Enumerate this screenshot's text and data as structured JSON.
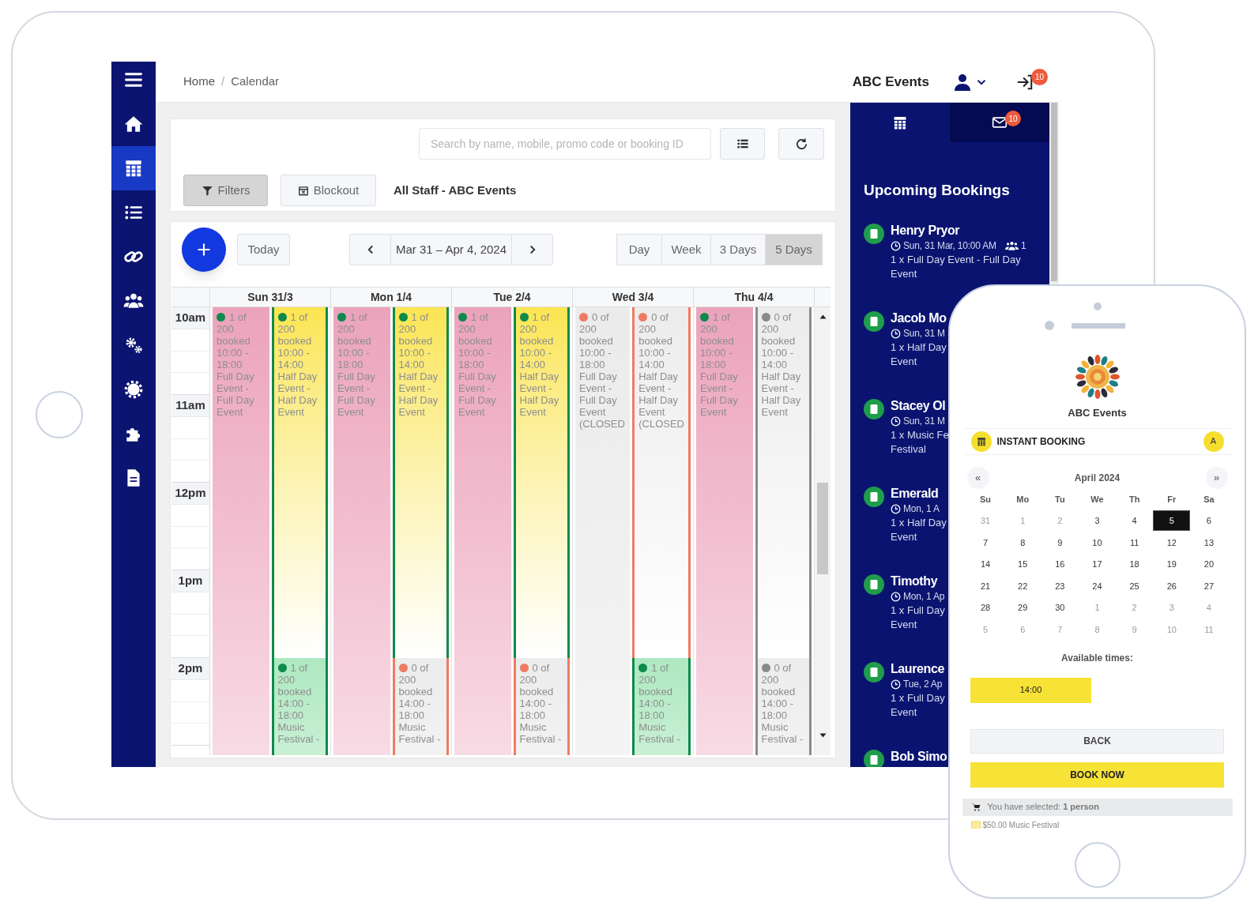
{
  "sidebar": {
    "items": [
      {
        "selected": false
      },
      {
        "selected": false
      },
      {
        "selected": true
      },
      {
        "selected": false
      },
      {
        "selected": false
      },
      {
        "selected": false
      },
      {
        "selected": false
      },
      {
        "selected": false
      },
      {
        "selected": false
      },
      {
        "selected": false
      }
    ]
  },
  "breadcrumb": {
    "items": [
      "Home",
      "Calendar"
    ],
    "separator": "/"
  },
  "header": {
    "org": "ABC Events",
    "notification_count": "10"
  },
  "search": {
    "placeholder": "Search by name, mobile, promo code or booking ID"
  },
  "filters_button": "Filters",
  "blockout_button": "Blockout",
  "staff_label": "All Staff - ABC Events",
  "toolbar": {
    "today": "Today",
    "range": "Mar 31 – Apr 4, 2024",
    "views": [
      {
        "label": "Day",
        "selected": false
      },
      {
        "label": "Week",
        "selected": false
      },
      {
        "label": "3 Days",
        "selected": false
      },
      {
        "label": "5 Days",
        "selected": true
      }
    ]
  },
  "calendar": {
    "hours": [
      "10am",
      "11am",
      "12pm",
      "1pm",
      "2pm"
    ],
    "days": [
      {
        "label": "Sun 31/3",
        "lanes": [
          {
            "events": [
              {
                "kind": "full_day",
                "booked": true,
                "color": "#0e8a4a",
                "count": "1 of 200 booked",
                "time": "10:00 - 18:00",
                "title": "Full Day Event - Full Day Event"
              }
            ]
          },
          {
            "events": [
              {
                "kind": "half_day",
                "booked": true,
                "color": "#0e8a4a",
                "count": "1 of 200 booked",
                "time": "10:00 - 14:00",
                "title": "Half Day Event - Half Day Event"
              },
              {
                "kind": "festival",
                "booked": true,
                "color": "#0e8a4a",
                "count": "1 of 200 booked",
                "time": "14:00 - 18:00",
                "title": "Music Festival -"
              }
            ]
          }
        ]
      },
      {
        "label": "Mon 1/4",
        "lanes": [
          {
            "events": [
              {
                "kind": "full_day",
                "booked": true,
                "color": "#0e8a4a",
                "count": "1 of 200 booked",
                "time": "10:00 - 18:00",
                "title": "Full Day Event - Full Day Event"
              }
            ]
          },
          {
            "events": [
              {
                "kind": "half_day",
                "booked": true,
                "color": "#0e8a4a",
                "count": "1 of 200 booked",
                "time": "10:00 - 14:00",
                "title": "Half Day Event - Half Day Event"
              },
              {
                "kind": "festival",
                "booked": false,
                "color": "#f07b62",
                "count": "0 of 200 booked",
                "time": "14:00 - 18:00",
                "title": "Music Festival -"
              }
            ]
          }
        ]
      },
      {
        "label": "Tue 2/4",
        "lanes": [
          {
            "events": [
              {
                "kind": "full_day",
                "booked": true,
                "color": "#0e8a4a",
                "count": "1 of 200 booked",
                "time": "10:00 - 18:00",
                "title": "Full Day Event - Full Day Event"
              }
            ]
          },
          {
            "events": [
              {
                "kind": "half_day",
                "booked": true,
                "color": "#0e8a4a",
                "count": "1 of 200 booked",
                "time": "10:00 - 14:00",
                "title": "Half Day Event - Half Day Event"
              },
              {
                "kind": "festival",
                "booked": false,
                "color": "#f07b62",
                "count": "0 of 200 booked",
                "time": "14:00 - 18:00",
                "title": "Music Festival -"
              }
            ]
          }
        ]
      },
      {
        "label": "Wed 3/4",
        "lanes": [
          {
            "events": [
              {
                "kind": "full_day",
                "booked": false,
                "color": "#f07b62",
                "count": "0 of 200 booked",
                "time": "10:00 - 18:00",
                "title": "Full Day Event - Full Day Event (CLOSED"
              }
            ]
          },
          {
            "events": [
              {
                "kind": "half_day",
                "booked": false,
                "color": "#f07b62",
                "count": "0 of 200 booked",
                "time": "10:00 - 14:00",
                "title": "Half Day Event - Half Day Event (CLOSED"
              },
              {
                "kind": "festival",
                "booked": true,
                "color": "#0e8a4a",
                "count": "1 of 200 booked",
                "time": "14:00 - 18:00",
                "title": "Music Festival -"
              }
            ]
          }
        ]
      },
      {
        "label": "Thu 4/4",
        "lanes": [
          {
            "events": [
              {
                "kind": "full_day",
                "booked": true,
                "color": "#0e8a4a",
                "count": "1 of 200 booked",
                "time": "10:00 - 18:00",
                "title": "Full Day Event - Full Day Event"
              }
            ]
          },
          {
            "events": [
              {
                "kind": "half_day",
                "booked": false,
                "color": "#8a8a8a",
                "count": "0 of 200 booked",
                "time": "10:00 - 14:00",
                "title": "Half Day Event - Half Day Event"
              },
              {
                "kind": "festival",
                "booked": false,
                "color": "#8a8a8a",
                "count": "0 of 200 booked",
                "time": "14:00 - 18:00",
                "title": "Music Festival -"
              }
            ]
          }
        ]
      }
    ]
  },
  "panel": {
    "tabs": [
      {
        "selected": true
      },
      {
        "selected": false,
        "badge": "10"
      }
    ],
    "title": "Upcoming Bookings",
    "bookings": [
      {
        "name": "Henry Pryor",
        "when": "Sun, 31 Mar, 10:00 AM",
        "guests": "1",
        "lines": [
          "1 x Full Day Event - Full Day",
          "Event"
        ]
      },
      {
        "name": "Jacob Mo",
        "when": "Sun, 31 M",
        "lines": [
          "1 x Half Day",
          "Event"
        ]
      },
      {
        "name": "Stacey Ol",
        "when": "Sun, 31 M",
        "lines": [
          "1 x Music Fe",
          "Festival"
        ]
      },
      {
        "name": "Emerald",
        "when": "Mon, 1 A",
        "lines": [
          "1 x Half Day",
          "Event"
        ]
      },
      {
        "name": "Timothy",
        "when": "Mon, 1 Ap",
        "lines": [
          "1 x Full Day",
          "Event"
        ]
      },
      {
        "name": "Laurence",
        "when": "Tue, 2 Ap",
        "lines": [
          "1 x Full Day",
          "Event"
        ]
      },
      {
        "name": "Bob Simo"
      }
    ]
  },
  "phone": {
    "org": "ABC Events",
    "booking_title": "INSTANT BOOKING",
    "avatar": "A",
    "prev": "«",
    "next": "»",
    "month": "April 2024",
    "weekdays": [
      "Su",
      "Mo",
      "Tu",
      "We",
      "Th",
      "Fr",
      "Sa"
    ],
    "weeks": [
      [
        {
          "day": "31",
          "muted": true,
          "selected": false
        },
        {
          "day": "1",
          "muted": true,
          "selected": false
        },
        {
          "day": "2",
          "muted": true,
          "selected": false
        },
        {
          "day": "3",
          "muted": false,
          "selected": false
        },
        {
          "day": "4",
          "muted": false,
          "selected": false
        },
        {
          "day": "5",
          "muted": false,
          "selected": true
        },
        {
          "day": "6",
          "muted": false,
          "selected": false
        }
      ],
      [
        {
          "day": "7",
          "muted": false,
          "selected": false
        },
        {
          "day": "8",
          "muted": false,
          "selected": false
        },
        {
          "day": "9",
          "muted": false,
          "selected": false
        },
        {
          "day": "10",
          "muted": false,
          "selected": false
        },
        {
          "day": "11",
          "muted": false,
          "selected": false
        },
        {
          "day": "12",
          "muted": false,
          "selected": false
        },
        {
          "day": "13",
          "muted": false,
          "selected": false
        }
      ],
      [
        {
          "day": "14",
          "muted": false,
          "selected": false
        },
        {
          "day": "15",
          "muted": false,
          "selected": false
        },
        {
          "day": "16",
          "muted": false,
          "selected": false
        },
        {
          "day": "17",
          "muted": false,
          "selected": false
        },
        {
          "day": "18",
          "muted": false,
          "selected": false
        },
        {
          "day": "19",
          "muted": false,
          "selected": false
        },
        {
          "day": "20",
          "muted": false,
          "selected": false
        }
      ],
      [
        {
          "day": "21",
          "muted": false,
          "selected": false
        },
        {
          "day": "22",
          "muted": false,
          "selected": false
        },
        {
          "day": "23",
          "muted": false,
          "selected": false
        },
        {
          "day": "24",
          "muted": false,
          "selected": false
        },
        {
          "day": "25",
          "muted": false,
          "selected": false
        },
        {
          "day": "26",
          "muted": false,
          "selected": false
        },
        {
          "day": "27",
          "muted": false,
          "selected": false
        }
      ],
      [
        {
          "day": "28",
          "muted": false,
          "selected": false
        },
        {
          "day": "29",
          "muted": false,
          "selected": false
        },
        {
          "day": "30",
          "muted": false,
          "selected": false
        },
        {
          "day": "1",
          "muted": true,
          "selected": false
        },
        {
          "day": "2",
          "muted": true,
          "selected": false
        },
        {
          "day": "3",
          "muted": true,
          "selected": false
        },
        {
          "day": "4",
          "muted": true,
          "selected": false
        }
      ],
      [
        {
          "day": "5",
          "muted": true,
          "selected": false
        },
        {
          "day": "6",
          "muted": true,
          "selected": false
        },
        {
          "day": "7",
          "muted": true,
          "selected": false
        },
        {
          "day": "8",
          "muted": true,
          "selected": false
        },
        {
          "day": "9",
          "muted": true,
          "selected": false
        },
        {
          "day": "10",
          "muted": true,
          "selected": false
        },
        {
          "day": "11",
          "muted": true,
          "selected": false
        }
      ]
    ],
    "times_label": "Available times:",
    "times": [
      "14:00"
    ],
    "back": "BACK",
    "book": "BOOK NOW",
    "selection": "You have selected: **1 person**",
    "item": "$50.00 Music Festival"
  }
}
